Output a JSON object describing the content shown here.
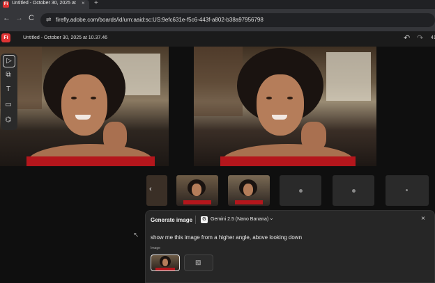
{
  "browser": {
    "tab_title": "Untitled - October 30, 2025 at",
    "tab_favicon": "Fi",
    "tab_close": "×",
    "new_tab": "+",
    "url": "firefly.adobe.com/boards/id/urn:aaid:sc:US:9efc631e-f5c6-443f-a802-b38a97956798",
    "nav_icons": [
      "back-icon",
      "forward-icon",
      "reload-icon",
      "site-info-icon"
    ],
    "back": "←",
    "forward": "→",
    "reload": "C",
    "site_info": "⇌"
  },
  "app": {
    "logo": "Fi",
    "title": "Untitled - October 30, 2025 at 10.37.46",
    "undo": "↶",
    "redo": "↷",
    "zoom": "41"
  },
  "toolbar": {
    "tools": [
      {
        "name": "select-tool",
        "glyph": "▷"
      },
      {
        "name": "frame-tool",
        "glyph": "⧉"
      },
      {
        "name": "text-tool",
        "glyph": "T"
      },
      {
        "name": "rectangle-tool",
        "glyph": "▭"
      },
      {
        "name": "shapes-tool",
        "glyph": "⌬"
      }
    ]
  },
  "filmstrip": {
    "prev_arrow": "‹",
    "thumbs_with_image": 2,
    "empty_slots": 3
  },
  "generate_panel": {
    "title": "Generate image",
    "model_badge": "G",
    "model_name": "Gemini 2.5 (Nano Banana)",
    "model_chevron": "⌄",
    "close": "×",
    "prompt": "show me this image from a higher angle, above looking down",
    "image_label": "Image",
    "add_image_icon": "▨"
  },
  "cursor": "↖",
  "colors": {
    "brand": "#e03434",
    "background": "#0f0f0f",
    "panel": "#262626"
  }
}
